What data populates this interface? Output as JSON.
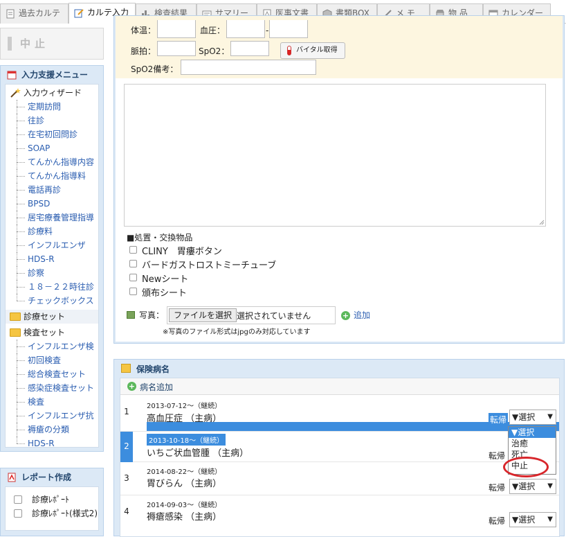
{
  "tabs": [
    {
      "label": "過去カルテ",
      "icon": "document-icon"
    },
    {
      "label": "カルテ入力",
      "icon": "edit-icon"
    },
    {
      "label": "検査結果",
      "icon": "bar-chart-icon"
    },
    {
      "label": "サマリー",
      "icon": "summary-icon"
    },
    {
      "label": "医事文書",
      "icon": "pdf-icon"
    },
    {
      "label": "書類BOX",
      "icon": "box-icon"
    },
    {
      "label": "メ モ",
      "icon": "pen-icon"
    },
    {
      "label": "物 品",
      "icon": "store-icon"
    },
    {
      "label": "カレンダー",
      "icon": "calendar-icon"
    }
  ],
  "sidebar": {
    "cancel_label": "中止",
    "support_menu": {
      "title": "入力支援メニュー",
      "wizard_label": "入力ウィザード",
      "wizard_items": [
        "定期訪問",
        "往診",
        "在宅初回問診",
        "SOAP",
        "てんかん指導内容",
        "てんかん指導料",
        "電話再診",
        "BPSD",
        "居宅療養管理指導",
        "診療料",
        "インフルエンザ",
        "HDS-R",
        "診察",
        "１８－２２時往診",
        "チェックボックス"
      ],
      "treatment_set_label": "診療セット",
      "exam_set_label": "検査セット",
      "exam_items": [
        "インフルエンザ検",
        "初回検査",
        "総合検査セット",
        "感染症検査セット",
        "検査",
        "インフルエンザ抗",
        "褥瘡の分類",
        "HDS-R"
      ]
    },
    "report": {
      "title": "レポート作成",
      "items": [
        "診療ﾚﾎﾟｰﾄ",
        "診療ﾚﾎﾟｰﾄ(様式2)"
      ]
    }
  },
  "vitals": {
    "temp_label": "体温：",
    "bp_label": "血圧：",
    "bp_sep": "-",
    "pulse_label": "脈拍：",
    "spo2_label": "SpO2：",
    "vital_button": "バイタル取得",
    "spo2_note_label": "SpO2備考："
  },
  "procedures": {
    "title": "■処置・交換物品",
    "items": [
      "CLINY　胃瘻ボタン",
      "バードガストロストミーチューブ",
      "Newシート",
      "頒布シート"
    ]
  },
  "photo": {
    "label": "写真：",
    "file_button": "ファイルを選択",
    "file_status": "選択されていません",
    "add_label": "追加",
    "note": "※写真のファイル形式はjpgのみ対応しています"
  },
  "insurance": {
    "title": "保険病名",
    "add_label": "病名追加",
    "outcome_label": "転帰",
    "rows": [
      {
        "num": "1",
        "date": "2013-07-12～（継続）",
        "name": "高血圧症 （主病）",
        "select": "▼選択"
      },
      {
        "num": "2",
        "date": "2013-10-18～（継続）",
        "name": "いちご状血管腫 （主病）",
        "select": "▼選択"
      },
      {
        "num": "3",
        "date": "2014-08-22～（継続）",
        "name": "胃びらん （主病）",
        "select": "▼選択"
      },
      {
        "num": "4",
        "date": "2014-09-03～（継続）",
        "name": "褥瘡感染 （主病）",
        "select": "▼選択"
      }
    ],
    "dropdown_options": [
      "▼選択",
      "治癒",
      "死亡",
      "中止"
    ]
  },
  "colors": {
    "accent": "#3c8dde",
    "panel_bg": "#dce9f6",
    "vitals_bg": "#fdf6e0",
    "highlight": "#d8262b"
  }
}
